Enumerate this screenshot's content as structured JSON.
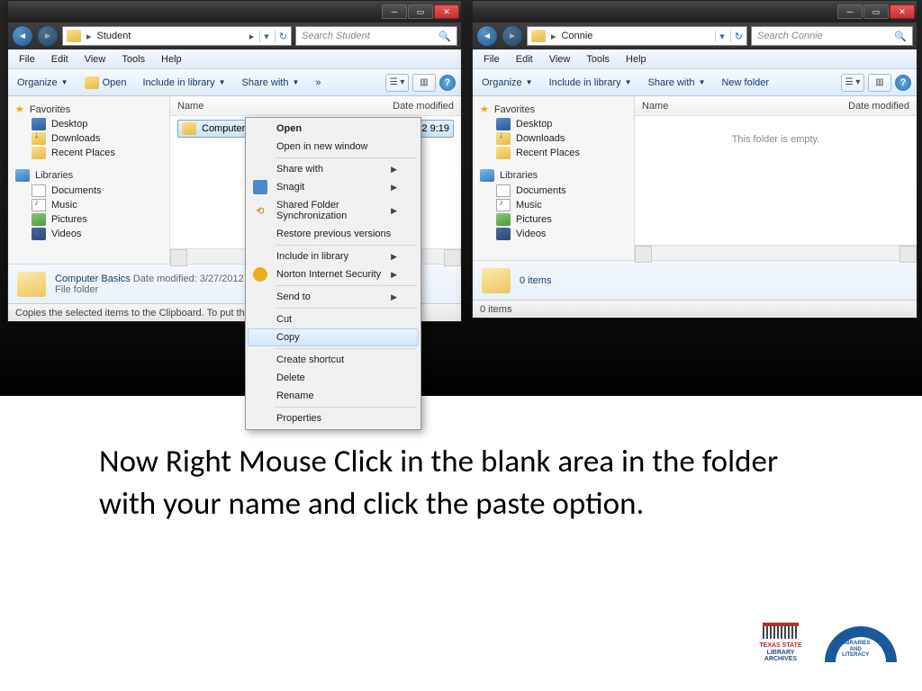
{
  "windows": {
    "left": {
      "address": "Student",
      "search_placeholder": "Search Student",
      "menus": [
        "File",
        "Edit",
        "View",
        "Tools",
        "Help"
      ],
      "toolbar": {
        "organize": "Organize",
        "open": "Open",
        "include": "Include in library",
        "share": "Share with",
        "more": "»"
      },
      "columns": {
        "name": "Name",
        "date": "Date modified"
      },
      "file": {
        "name": "Computer Basics",
        "date": "3/27/2012 9:19"
      },
      "details": {
        "name": "Computer Basics",
        "mod_label": "Date modified:",
        "mod": "3/27/2012",
        "type": "File folder"
      },
      "status": "Copies the selected items to the Clipboard. To put them in"
    },
    "right": {
      "address": "Connie",
      "search_placeholder": "Search Connie",
      "menus": [
        "File",
        "Edit",
        "View",
        "Tools",
        "Help"
      ],
      "toolbar": {
        "organize": "Organize",
        "include": "Include in library",
        "share": "Share with",
        "newfolder": "New folder"
      },
      "columns": {
        "name": "Name",
        "date": "Date modified"
      },
      "empty": "This folder is empty.",
      "details": {
        "count": "0 items"
      },
      "status": "0 items"
    }
  },
  "sidebar": {
    "favorites": "Favorites",
    "desktop": "Desktop",
    "downloads": "Downloads",
    "recent": "Recent Places",
    "libraries": "Libraries",
    "documents": "Documents",
    "music": "Music",
    "pictures": "Pictures",
    "videos": "Videos"
  },
  "context_menu": {
    "open": "Open",
    "open_new": "Open in new window",
    "share_with": "Share with",
    "snagit": "Snagit",
    "shared_sync": "Shared Folder Synchronization",
    "restore": "Restore previous versions",
    "include_lib": "Include in library",
    "norton": "Norton Internet Security",
    "send_to": "Send to",
    "cut": "Cut",
    "copy": "Copy",
    "shortcut": "Create shortcut",
    "delete": "Delete",
    "rename": "Rename",
    "properties": "Properties"
  },
  "instruction": "Now Right Mouse Click in the blank area in the folder with your name and click the paste option.",
  "logos": {
    "l1a": "TEXAS STATE",
    "l1b": "LIBRARY",
    "l1c": "ARCHIVES",
    "l2a": "LIBRARIES",
    "l2b": "AND",
    "l2c": "LITERACY"
  }
}
